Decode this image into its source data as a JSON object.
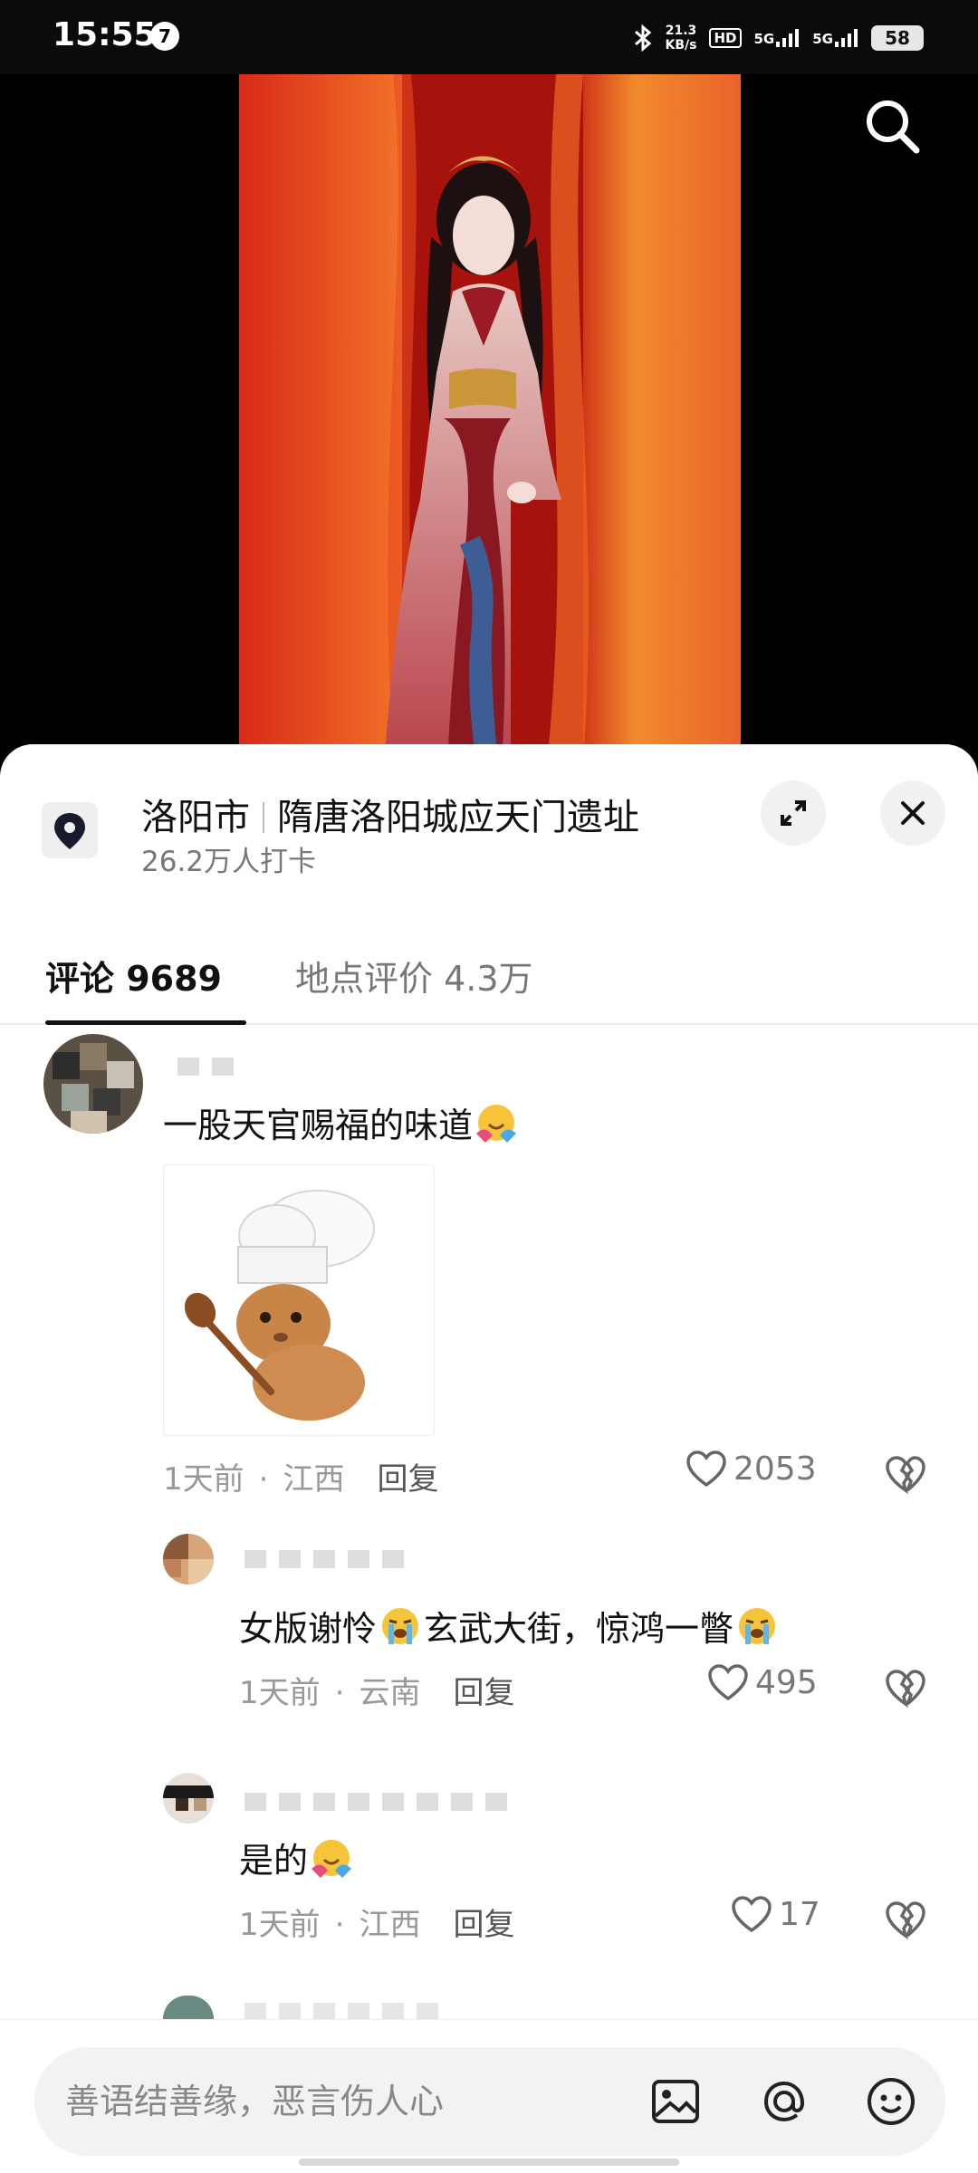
{
  "status_bar": {
    "time": "15:55",
    "notification_count": "7",
    "net_speed_value": "21.3",
    "net_speed_unit": "KB/s",
    "hd_label": "HD",
    "signal_1": "5G",
    "signal_2": "5G",
    "battery": "58"
  },
  "location": {
    "city": "洛阳市",
    "place": "隋唐洛阳城应天门遗址",
    "checkins": "26.2万人打卡"
  },
  "tabs": [
    {
      "label": "评论 9689",
      "active": true
    },
    {
      "label": "地点评价 4.3万",
      "active": false
    }
  ],
  "comments": [
    {
      "text": "一股天官赐福的味道",
      "emoji": "hugging-face",
      "has_sticker": true,
      "time": "1天前",
      "region": "江西",
      "reply": "回复",
      "likes": "2053"
    },
    {
      "text_before": "女版谢怜",
      "text_middle": "玄武大街，惊鸿一瞥",
      "emoji": "loudly-crying-face",
      "time": "1天前",
      "region": "云南",
      "reply": "回复",
      "likes": "495"
    },
    {
      "text": "是的",
      "emoji": "hugging-face",
      "time": "1天前",
      "region": "江西",
      "reply": "回复",
      "likes": "17"
    }
  ],
  "input": {
    "placeholder": "善语结善缘，恶言伤人心"
  },
  "icons": [
    "search-icon",
    "location-pin-icon",
    "expand-icon",
    "close-icon",
    "heart-icon",
    "broken-heart-icon",
    "image-icon",
    "at-icon",
    "emoji-icon"
  ]
}
